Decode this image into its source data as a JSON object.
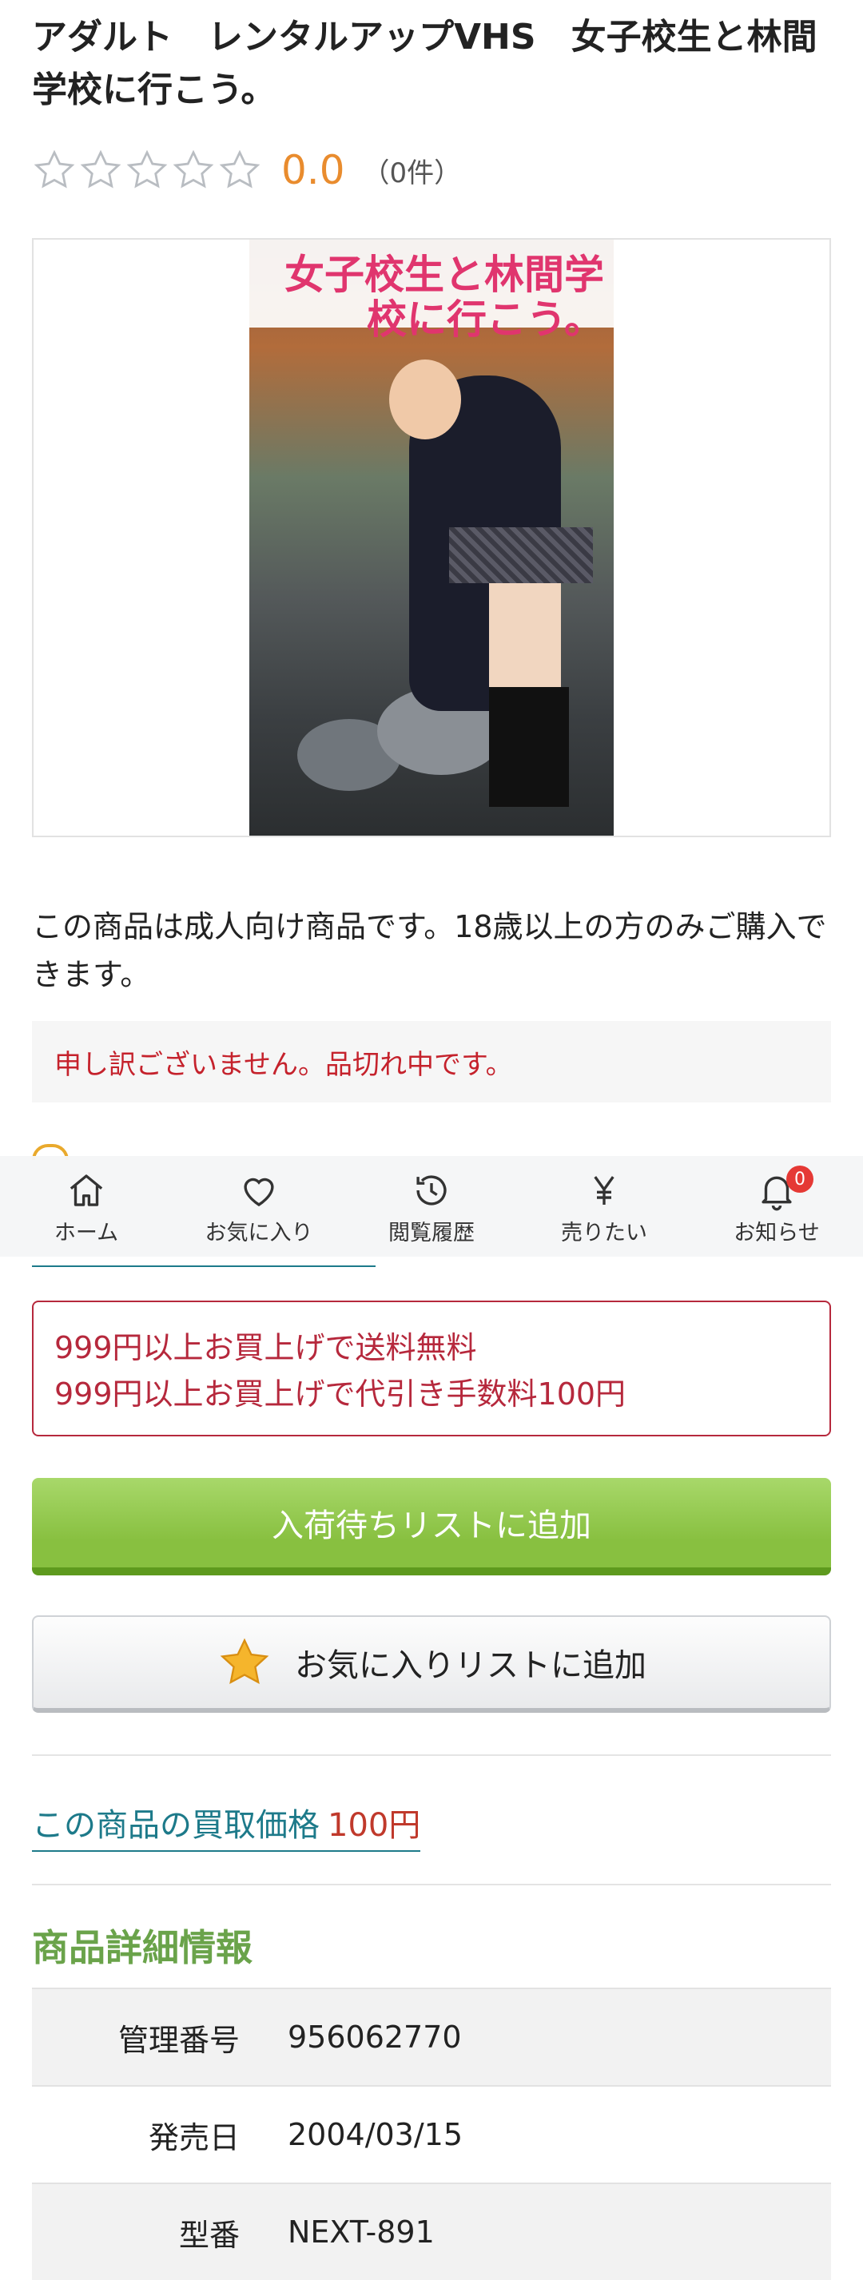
{
  "product": {
    "title": "アダルト　レンタルアップVHS　女子校生と林間学校に行こう。",
    "rating": {
      "value": "0.0",
      "count_label": "（0件）",
      "stars_filled": 0,
      "stars_total": 5
    },
    "cover_title": "女子校生と林間学校に行こう。",
    "adult_notice": "この商品は成人向け商品です。18歳以上の方のみご購入できます。",
    "soldout_message": "申し訳ございません。品切れ中です。"
  },
  "bottom_nav": {
    "items": [
      {
        "label": "ホーム",
        "icon": "home-icon"
      },
      {
        "label": "お気に入り",
        "icon": "heart-icon"
      },
      {
        "label": "閲覧履歴",
        "icon": "history-icon"
      },
      {
        "label": "売りたい",
        "icon": "yen-icon"
      },
      {
        "label": "お知らせ",
        "icon": "bell-icon",
        "badge": "0"
      }
    ]
  },
  "shipping": {
    "line1": "999円以上お買上げで送料無料",
    "line2": "999円以上お買上げで代引き手数料100円"
  },
  "buttons": {
    "waitlist_label": "入荷待ちリストに追加",
    "favorite_label": "お気に入りリストに追加"
  },
  "buyback": {
    "label": "この商品の買取価格",
    "price": "100円"
  },
  "details": {
    "heading": "商品詳細情報",
    "rows": [
      {
        "key": "管理番号",
        "value": "956062770"
      },
      {
        "key": "発売日",
        "value": "2004/03/15"
      },
      {
        "key": "型番",
        "value": "NEXT-891"
      }
    ]
  },
  "colors": {
    "rating": "#e98c2e",
    "soldout": "#c5222c",
    "shipping": "#b6283c",
    "waitlist_button": "#88c040",
    "link": "#1d7a8a",
    "heading": "#6aa34a"
  }
}
